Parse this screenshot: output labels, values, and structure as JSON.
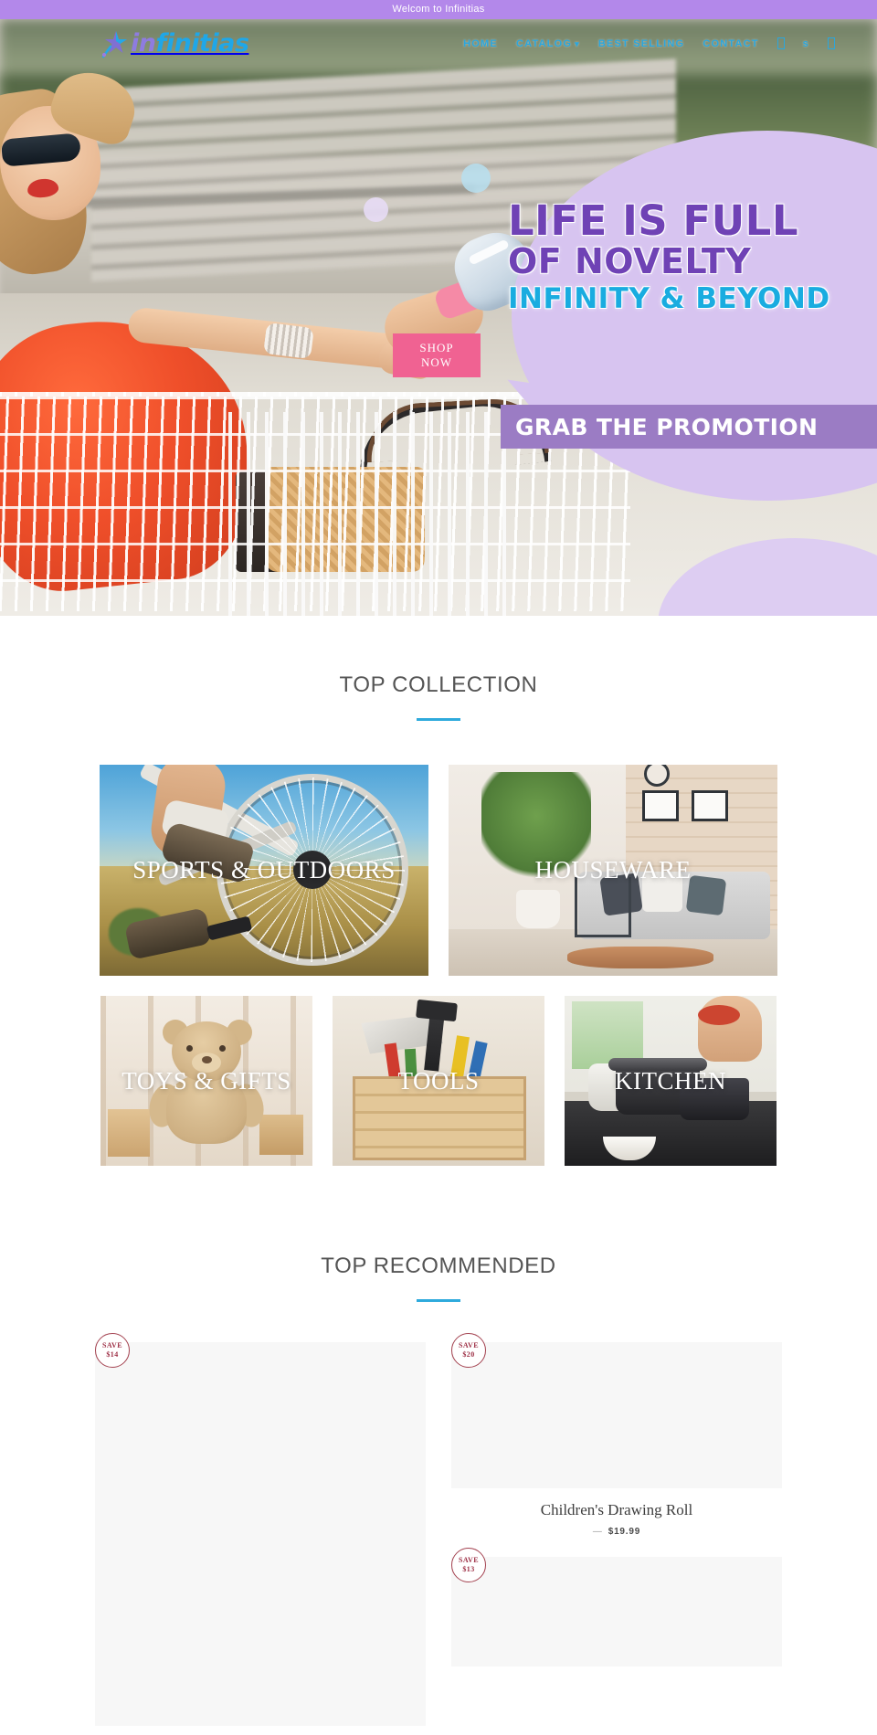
{
  "announcement": {
    "text": "Welcom to Infinitias"
  },
  "brand": {
    "name_part1": "in",
    "name_part2": "finitias",
    "logo_icon": "comet-star-icon"
  },
  "nav": {
    "items": [
      {
        "label": "HOME",
        "has_dropdown": false
      },
      {
        "label": "CATALOG",
        "has_dropdown": true,
        "caret": "▾"
      },
      {
        "label": "BEST SELLING",
        "has_dropdown": false
      },
      {
        "label": "CONTACT",
        "has_dropdown": false
      }
    ],
    "icons": [
      {
        "name": "search-icon",
        "glyph": ""
      },
      {
        "name": "currency-icon",
        "glyph": "s"
      },
      {
        "name": "cart-icon",
        "glyph": ""
      }
    ]
  },
  "hero": {
    "line1": "LIFE IS FULL",
    "line2": "OF NOVELTY",
    "line3": "INFINITY & BEYOND",
    "promo": "GRAB THE PROMOTION",
    "cta_line1": "SHOP",
    "cta_line2": "NOW",
    "colors": {
      "purple": "#6f42b5",
      "blue": "#19ace0",
      "promo_bg": "#9b7cc4",
      "cta_bg": "#f06292"
    }
  },
  "collection": {
    "title": "TOP COLLECTION",
    "accent_color": "#2eaadc",
    "tiles": [
      {
        "label": "SPORTS & OUTDOORS",
        "size": "large"
      },
      {
        "label": "HOUSEWARE",
        "size": "large"
      },
      {
        "label": "TOYS & GIFTS",
        "size": "small"
      },
      {
        "label": "TOOLS",
        "size": "small"
      },
      {
        "label": "KITCHEN",
        "size": "small"
      }
    ]
  },
  "recommended": {
    "title": "TOP RECOMMENDED",
    "accent_color": "#2eaadc",
    "badge_color": "#9d2f45",
    "products": [
      {
        "badge_label": "SAVE",
        "badge_amount": "$14",
        "title": "",
        "price": ""
      },
      {
        "badge_label": "SAVE",
        "badge_amount": "$20",
        "title": "Children's Drawing Roll",
        "price": "$19.99",
        "price_dash": "—"
      },
      {
        "badge_label": "SAVE",
        "badge_amount": "$13",
        "title": "",
        "price": ""
      }
    ]
  }
}
